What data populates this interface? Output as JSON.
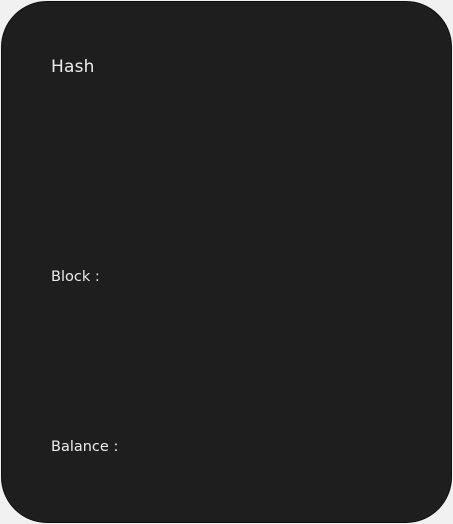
{
  "card": {
    "title": "Hash",
    "block_label": "Block :",
    "balance_label": "Balance :"
  }
}
